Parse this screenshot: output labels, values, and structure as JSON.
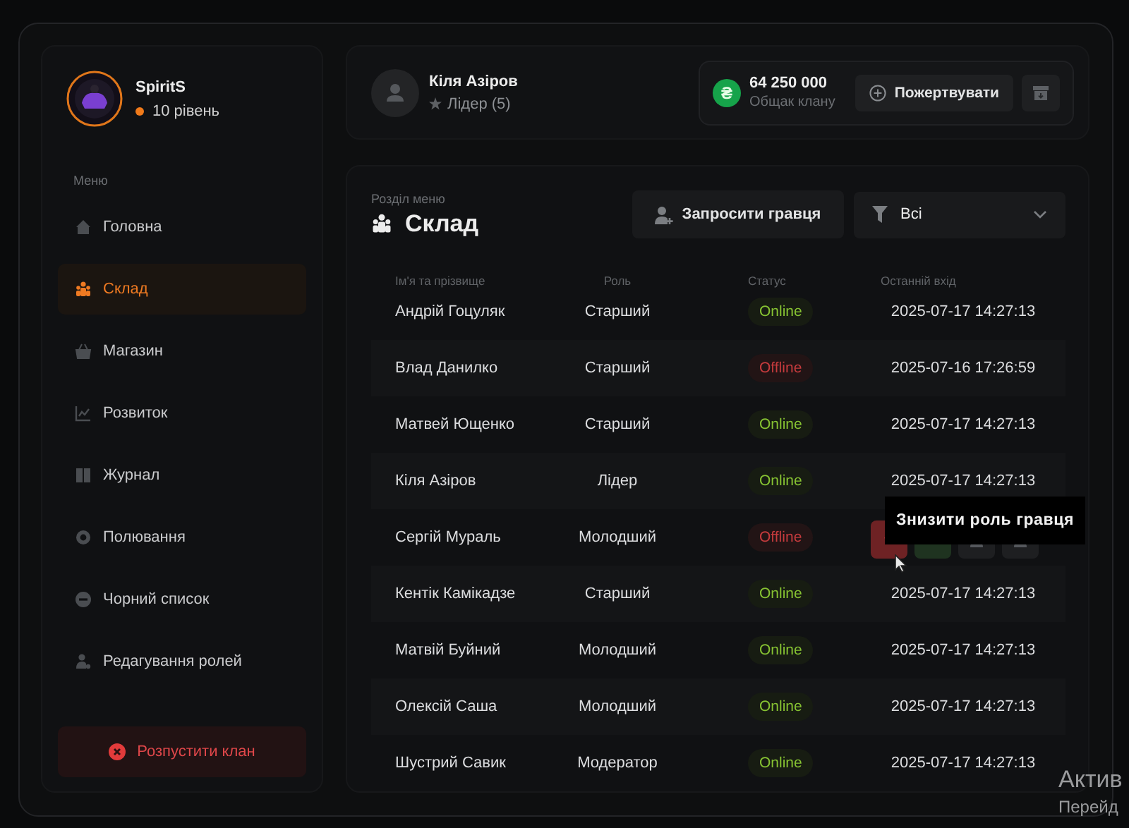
{
  "profile": {
    "name": "SpiritS",
    "level": "10 рівень"
  },
  "menu": {
    "heading": "Меню",
    "items": [
      {
        "label": "Головна",
        "selected": false
      },
      {
        "label": "Склад",
        "selected": true
      },
      {
        "label": "Магазин",
        "selected": false
      },
      {
        "label": "Розвиток",
        "selected": false
      },
      {
        "label": "Журнал",
        "selected": false
      },
      {
        "label": "Полювання",
        "selected": false
      },
      {
        "label": "Чорний список",
        "selected": false
      },
      {
        "label": "Редагування ролей",
        "selected": false
      }
    ]
  },
  "disband_button": "Розпустити клан",
  "leader": {
    "name": "Кіля Азіров",
    "role": "Лідер (5)"
  },
  "treasury": {
    "currency_symbol": "₴",
    "amount": "64 250 000",
    "label": "Общак клану"
  },
  "donate_button": "Пожертвувати",
  "section": {
    "caption": "Розділ меню",
    "title": "Склад"
  },
  "invite_button": "Запросити гравця",
  "filter": {
    "value": "Всі"
  },
  "table": {
    "columns": [
      "Ім'я та прізвище",
      "Роль",
      "Статус",
      "Останній вхід"
    ],
    "rows": [
      {
        "name": "Андрій Гоцуляк",
        "role": "Старший",
        "status": "Online",
        "online": true,
        "last_login": "2025-07-17 14:27:13",
        "hovered": false
      },
      {
        "name": "Влад Данилко",
        "role": "Старший",
        "status": "Offline",
        "online": false,
        "last_login": "2025-07-16 17:26:59",
        "hovered": false
      },
      {
        "name": "Матвей Ющенко",
        "role": "Старший",
        "status": "Online",
        "online": true,
        "last_login": "2025-07-17 14:27:13",
        "hovered": false
      },
      {
        "name": "Кіля Азіров",
        "role": "Лідер",
        "status": "Online",
        "online": true,
        "last_login": "2025-07-17 14:27:13",
        "hovered": false
      },
      {
        "name": "Сергій Мураль",
        "role": "Молодший",
        "status": "Offline",
        "online": false,
        "hovered": true
      },
      {
        "name": "Кентік Камікадзе",
        "role": "Старший",
        "status": "Online",
        "online": true,
        "last_login": "2025-07-17 14:27:13",
        "hovered": false
      },
      {
        "name": "Матвій Буйний",
        "role": "Молодший",
        "status": "Online",
        "online": true,
        "last_login": "2025-07-17 14:27:13",
        "hovered": false
      },
      {
        "name": "Олексій Саша",
        "role": "Молодший",
        "status": "Online",
        "online": true,
        "last_login": "2025-07-17 14:27:13",
        "hovered": false
      },
      {
        "name": "Шустрий Савик",
        "role": "Модератор",
        "status": "Online",
        "online": true,
        "last_login": "2025-07-17 14:27:13",
        "hovered": false
      }
    ]
  },
  "tooltip": "Знизити роль гравця",
  "os_notice": [
    "Актив",
    "Перейд"
  ]
}
